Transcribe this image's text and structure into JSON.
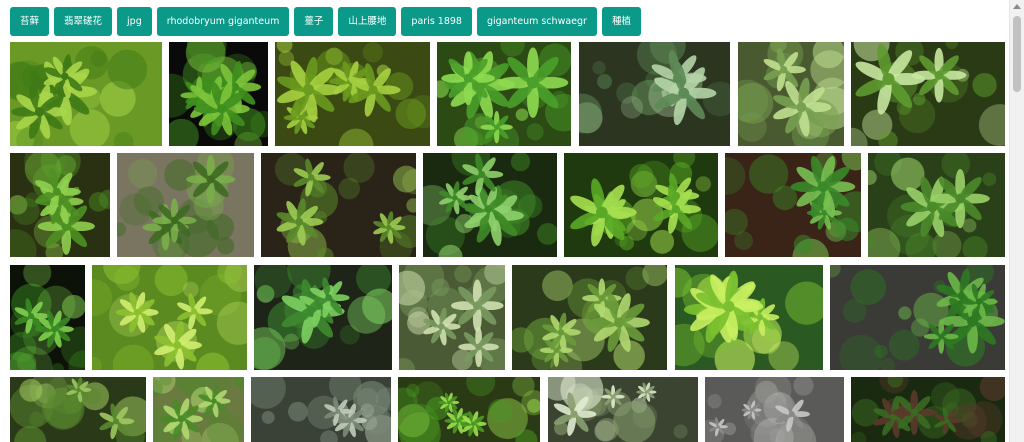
{
  "tags": [
    {
      "label": "苔藓"
    },
    {
      "label": "翡翠磋花"
    },
    {
      "label": "jpg"
    },
    {
      "label": "rhodobryum giganteum"
    },
    {
      "label": "薹子"
    },
    {
      "label": "山上腰地"
    },
    {
      "label": "paris 1898"
    },
    {
      "label": "giganteum schwaegr"
    },
    {
      "label": "種植"
    }
  ],
  "images": [
    {
      "alt": "moss-rosette-1",
      "bg": "#6a9a25",
      "fg": "#3f7a16",
      "hi": "#a8d64a"
    },
    {
      "alt": "moss-rosette-dark-1",
      "bg": "#0a0a0a",
      "fg": "#3f8f1e",
      "hi": "#7cc43a"
    },
    {
      "alt": "moss-feathery-1",
      "bg": "#3a4a12",
      "fg": "#6a9a1e",
      "hi": "#a6d040"
    },
    {
      "alt": "moss-star-1",
      "bg": "#2c4a14",
      "fg": "#4aa02a",
      "hi": "#8edc50"
    },
    {
      "alt": "moss-star-2",
      "bg": "#2b3520",
      "fg": "#5e8a56",
      "hi": "#b4d4a6"
    },
    {
      "alt": "moss-rosette-2",
      "bg": "#4a5a30",
      "fg": "#78a050",
      "hi": "#c0e090"
    },
    {
      "alt": "moss-red-stems",
      "bg": "#2a3a14",
      "fg": "#5e9a30",
      "hi": "#c8e8a0"
    },
    {
      "alt": "moss-rosette-3",
      "bg": "#2a3012",
      "fg": "#4e9022",
      "hi": "#90d050"
    },
    {
      "alt": "moss-rosette-4",
      "bg": "#7a7560",
      "fg": "#3e6a22",
      "hi": "#7aae4a"
    },
    {
      "alt": "moss-pot-1",
      "bg": "#2a2418",
      "fg": "#5a8a2a",
      "hi": "#9ccc52"
    },
    {
      "alt": "moss-rosette-5",
      "bg": "#1a2a10",
      "fg": "#3f8a28",
      "hi": "#8ed06c"
    },
    {
      "alt": "moss-curled-1",
      "bg": "#1e3a0e",
      "fg": "#5aa826",
      "hi": "#a6e050"
    },
    {
      "alt": "moss-carpet-1",
      "bg": "#3a2418",
      "fg": "#3a8a2a",
      "hi": "#78c050"
    },
    {
      "alt": "moss-coin-1",
      "bg": "#2a4018",
      "fg": "#4a8a2a",
      "hi": "#9ad068"
    },
    {
      "alt": "moss-dark-star",
      "bg": "#0c1208",
      "fg": "#3a8a22",
      "hi": "#80d050"
    },
    {
      "alt": "moss-bright-field",
      "bg": "#5a8a20",
      "fg": "#8cc030",
      "hi": "#d0ee70"
    },
    {
      "alt": "moss-rosette-6",
      "bg": "#1e2418",
      "fg": "#3e8a30",
      "hi": "#7cd060"
    },
    {
      "alt": "moss-star-3",
      "bg": "#4a5a34",
      "fg": "#7a9a60",
      "hi": "#d0e0b0"
    },
    {
      "alt": "moss-rosette-7",
      "bg": "#2a3a1a",
      "fg": "#6a9a3a",
      "hi": "#b0d870"
    },
    {
      "alt": "moss-feathery-2",
      "bg": "#2a5a22",
      "fg": "#7ac030",
      "hi": "#c8f060"
    },
    {
      "alt": "moss-rosette-8",
      "bg": "#3a3a36",
      "fg": "#2e7a22",
      "hi": "#6cb848"
    },
    {
      "alt": "moss-bottom-1",
      "bg": "#2a3a18",
      "fg": "#5a8a30",
      "hi": "#a0c860"
    },
    {
      "alt": "moss-bottom-2",
      "bg": "#6a7a40",
      "fg": "#4a8a28",
      "hi": "#b0d870"
    },
    {
      "alt": "moss-bottom-3",
      "bg": "#3a4238",
      "fg": "#7a8a78",
      "hi": "#c0ccb8"
    },
    {
      "alt": "moss-bottom-4",
      "bg": "#2a3a14",
      "fg": "#4a9a22",
      "hi": "#a0e050"
    },
    {
      "alt": "moss-bottom-5",
      "bg": "#3a4430",
      "fg": "#8aa070",
      "hi": "#e0ecd0"
    },
    {
      "alt": "moss-bottom-6",
      "bg": "#5a5a58",
      "fg": "#8a8a88",
      "hi": "#c8c8c6"
    },
    {
      "alt": "moss-bottom-7",
      "bg": "#1a2a10",
      "fg": "#3a6a22",
      "hi": "#5a3a2a"
    }
  ]
}
